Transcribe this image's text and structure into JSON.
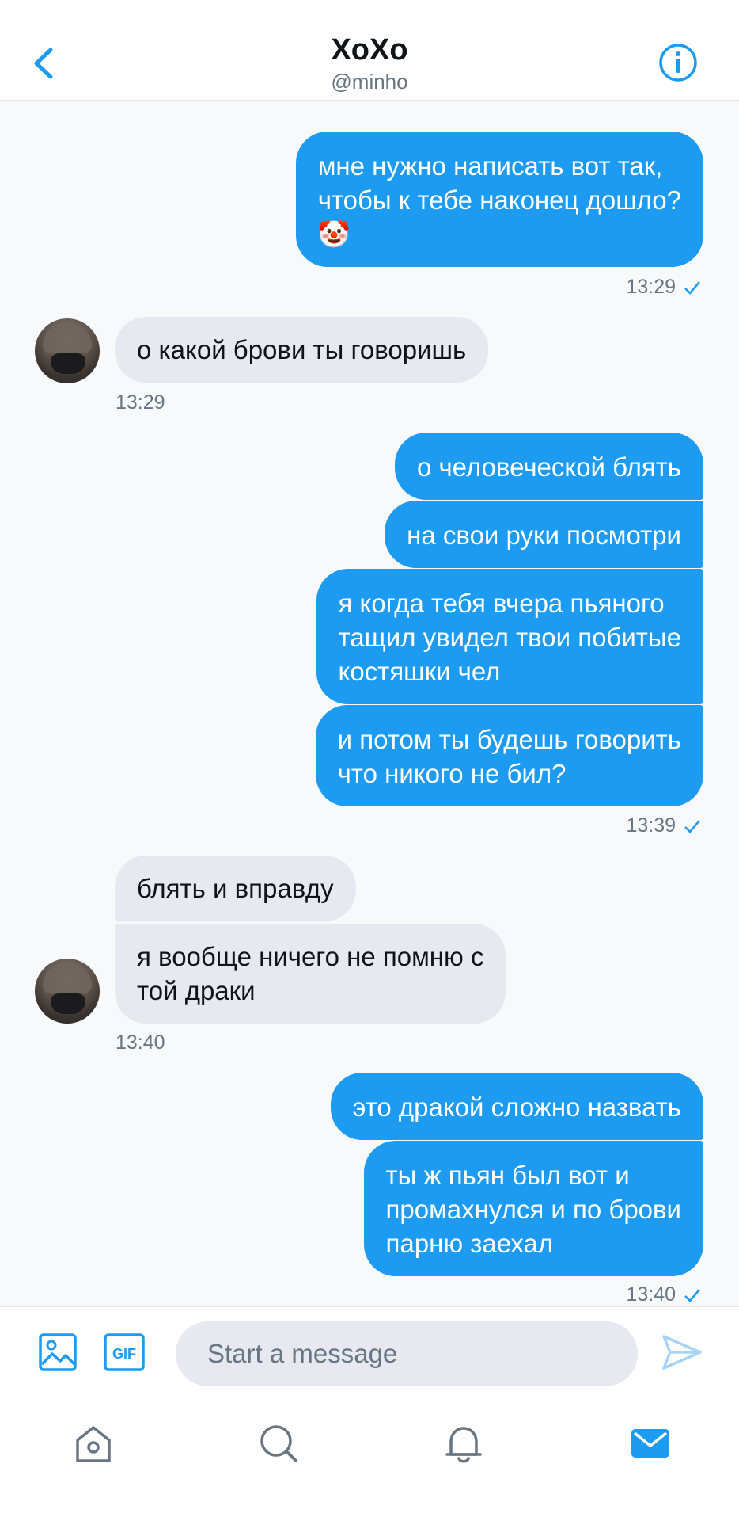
{
  "header": {
    "title": "XoXo",
    "handle": "@minho",
    "back_icon": "chevron-left-icon",
    "info_icon": "info-icon"
  },
  "messages": [
    {
      "dir": "out",
      "text": "мне нужно написать вот так,\nчтобы к тебе наконец дошло?\n🤡"
    },
    {
      "dir": "out_time",
      "text": "13:29"
    },
    {
      "dir": "in",
      "text": "о какой брови ты говоришь"
    },
    {
      "dir": "in_time",
      "text": "13:29"
    },
    {
      "dir": "out",
      "text": "о человеческой блять"
    },
    {
      "dir": "out",
      "text": "на свои руки посмотри"
    },
    {
      "dir": "out",
      "text": "я когда тебя вчера пьяного\nтащил увидел твои побитые\nкостяшки чел"
    },
    {
      "dir": "out",
      "text": "и потом ты будешь говорить\nчто никого не бил?"
    },
    {
      "dir": "out_time",
      "text": "13:39"
    },
    {
      "dir": "in",
      "text": "блять и вправду"
    },
    {
      "dir": "in",
      "text": "я вообще ничего не помню с\nтой драки"
    },
    {
      "dir": "in_time",
      "text": "13:40"
    },
    {
      "dir": "out",
      "text": "это дракой сложно назвать"
    },
    {
      "dir": "out",
      "text": "ты ж пьян был вот и\nпромахнулся и по брови\nпарню заехал"
    },
    {
      "dir": "out_time",
      "text": "13:40"
    }
  ],
  "composer": {
    "placeholder": "Start a message",
    "gif_label": "GIF"
  },
  "tabbar": {
    "items": [
      "home-icon",
      "search-icon",
      "notifications-icon",
      "messages-icon"
    ],
    "active": "messages-icon"
  },
  "colors": {
    "accent": "#1d9bf0",
    "incoming_bubble": "#e7e8f0",
    "secondary_text": "#687684"
  }
}
